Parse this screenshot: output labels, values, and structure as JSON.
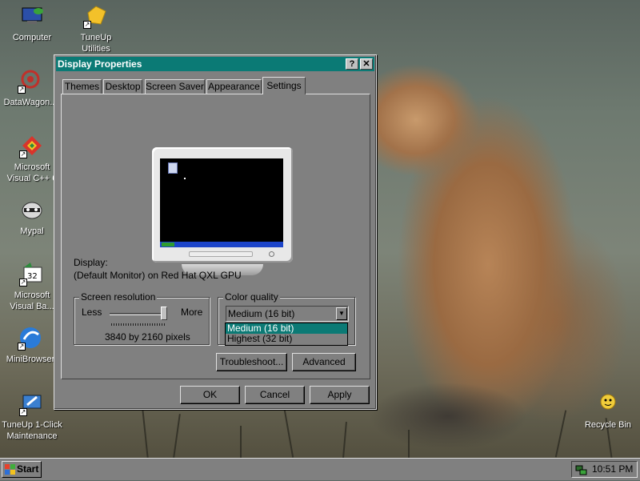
{
  "desktop": {
    "icons": [
      {
        "label": "Computer",
        "icon": "computer-icon"
      },
      {
        "label": "TuneUp Utilities\n2011",
        "icon": "tuneup-icon"
      },
      {
        "label": "DataWagon...",
        "icon": "datawagon-icon"
      },
      {
        "label": "Microsoft\nVisual C++ 6",
        "icon": "visual-cpp-icon"
      },
      {
        "label": "Mypal",
        "icon": "mypal-icon"
      },
      {
        "label": "Microsoft\nVisual Ba...",
        "icon": "visual-basic-icon"
      },
      {
        "label": "MiniBrowser",
        "icon": "minibrowser-icon"
      },
      {
        "label": "TuneUp 1-Click\nMaintenance",
        "icon": "tuneup-maintenance-icon"
      },
      {
        "label": "Recycle Bin",
        "icon": "recycle-bin-icon"
      }
    ]
  },
  "dialog": {
    "title": "Display Properties",
    "help_glyph": "?",
    "close_glyph": "✕",
    "tabs": [
      {
        "label": "Themes"
      },
      {
        "label": "Desktop"
      },
      {
        "label": "Screen Saver"
      },
      {
        "label": "Appearance"
      },
      {
        "label": "Settings",
        "active": true
      }
    ],
    "display_label": "Display:",
    "display_value": "(Default Monitor) on Red Hat QXL GPU",
    "resolution": {
      "title": "Screen resolution",
      "less": "Less",
      "more": "More",
      "slider_position": 1.0,
      "value": "3840 by 2160 pixels"
    },
    "color_quality": {
      "title": "Color quality",
      "selected": "Medium (16 bit)",
      "options": [
        "Medium (16 bit)",
        "Highest (32 bit)"
      ],
      "highlighted_index": 0
    },
    "troubleshoot_label": "Troubleshoot...",
    "advanced_label": "Advanced",
    "ok_label": "OK",
    "cancel_label": "Cancel",
    "apply_label": "Apply"
  },
  "taskbar": {
    "start_label": "Start",
    "clock": "10:51 PM"
  },
  "colors": {
    "title_bar": "#0b7a75",
    "selection": "#0b7a75",
    "window_face": "#808080"
  }
}
